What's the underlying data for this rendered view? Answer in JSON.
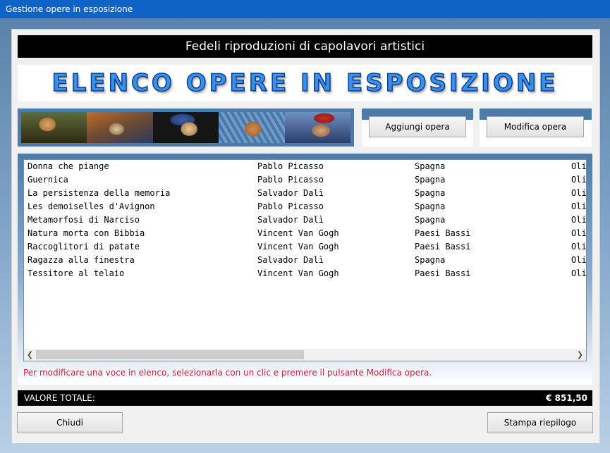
{
  "window": {
    "title": "Gestione opere in esposizione"
  },
  "header": {
    "subtitle": "Fedeli riproduzioni di capolavori artistici"
  },
  "banner": {
    "title": "ELENCO OPERE IN ESPOSIZIONE"
  },
  "toolbar": {
    "add_label": "Aggiungi opera",
    "edit_label": "Modifica opera"
  },
  "artworks": [
    {
      "title": "Donna che piange",
      "artist": "Pablo Picasso",
      "country": "Spagna",
      "technique": "Oli"
    },
    {
      "title": "Guernica",
      "artist": "Pablo Picasso",
      "country": "Spagna",
      "technique": "Oli"
    },
    {
      "title": "La persistenza della memoria",
      "artist": "Salvador Dalì",
      "country": "Spagna",
      "technique": "Oli"
    },
    {
      "title": "Les demoiselles d'Avignon",
      "artist": "Pablo Picasso",
      "country": "Spagna",
      "technique": "Oli"
    },
    {
      "title": "Metamorfosi di Narciso",
      "artist": "Salvador Dalì",
      "country": "Spagna",
      "technique": "Oli"
    },
    {
      "title": "Natura morta con Bibbia",
      "artist": "Vincent Van Gogh",
      "country": "Paesi Bassi",
      "technique": "Oli"
    },
    {
      "title": "Raccoglitori di patate",
      "artist": "Vincent Van Gogh",
      "country": "Paesi Bassi",
      "technique": "Oli"
    },
    {
      "title": "Ragazza alla finestra",
      "artist": "Salvador Dalì",
      "country": "Spagna",
      "technique": "Oli"
    },
    {
      "title": "Tessitore al telaio",
      "artist": "Vincent Van Gogh",
      "country": "Paesi Bassi",
      "technique": "Oli"
    }
  ],
  "hint": "Per modificare una voce in elenco, selezionarla con un clic e premere il pulsante Modifica opera.",
  "total": {
    "label": "VALORE TOTALE:",
    "value": "€ 851,50"
  },
  "footer": {
    "close_label": "Chiudi",
    "print_label": "Stampa riepilogo"
  },
  "icons": {
    "scroll_left": "chevron-left-icon",
    "scroll_right": "chevron-right-icon"
  },
  "colors": {
    "titlebar": "#0f63c7",
    "accent": "#4a7cab",
    "hint": "#c0283a"
  }
}
